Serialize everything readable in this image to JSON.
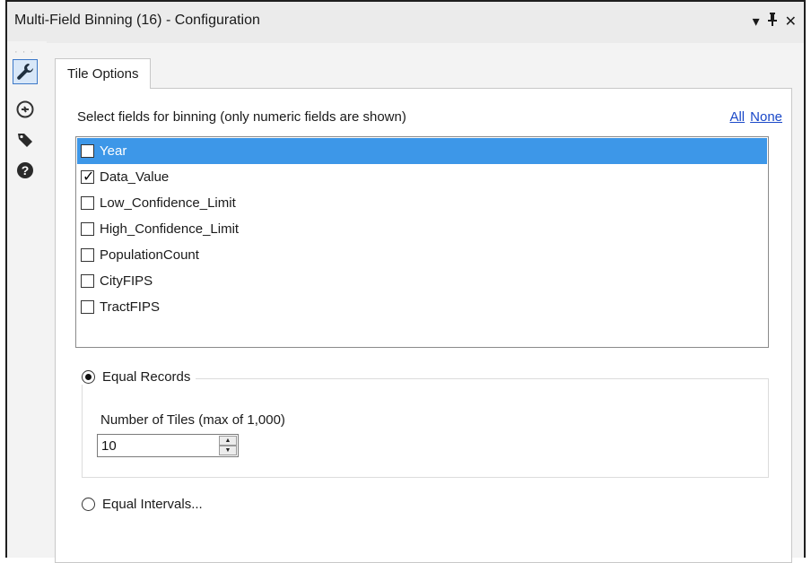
{
  "window": {
    "title": "Multi-Field Binning (16) - Configuration",
    "controls": [
      {
        "name": "dropdown-arrow-icon",
        "glyph": "▾"
      },
      {
        "name": "pin-icon",
        "glyph": "📌"
      },
      {
        "name": "close-icon",
        "glyph": "✕"
      }
    ]
  },
  "left_rail": {
    "grip": "·  ·  ·",
    "buttons": [
      {
        "name": "wrench-icon",
        "active": true
      },
      {
        "name": "annotation-icon",
        "active": false
      },
      {
        "name": "tag-icon",
        "active": false
      },
      {
        "name": "help-icon",
        "active": false
      }
    ]
  },
  "tab": {
    "label": "Tile Options"
  },
  "fields_section": {
    "instruction": "Select fields for binning (only numeric fields are shown)",
    "link_all": "All",
    "link_none": "None",
    "fields": [
      {
        "label": "Year",
        "checked": false,
        "selected": true
      },
      {
        "label": "Data_Value",
        "checked": true,
        "selected": false
      },
      {
        "label": "Low_Confidence_Limit",
        "checked": false,
        "selected": false
      },
      {
        "label": "High_Confidence_Limit",
        "checked": false,
        "selected": false
      },
      {
        "label": "PopulationCount",
        "checked": false,
        "selected": false
      },
      {
        "label": "CityFIPS",
        "checked": false,
        "selected": false
      },
      {
        "label": "TractFIPS",
        "checked": false,
        "selected": false
      }
    ]
  },
  "equal_records": {
    "label": "Equal Records",
    "selected": true,
    "tiles_label": "Number of Tiles (max of 1,000)",
    "tiles_value": "10"
  },
  "equal_intervals": {
    "label": "Equal Intervals...",
    "selected": false
  },
  "colors": {
    "selection": "#3d97e8",
    "link": "#1a48c8",
    "active_rail": "#d8e7f8"
  }
}
